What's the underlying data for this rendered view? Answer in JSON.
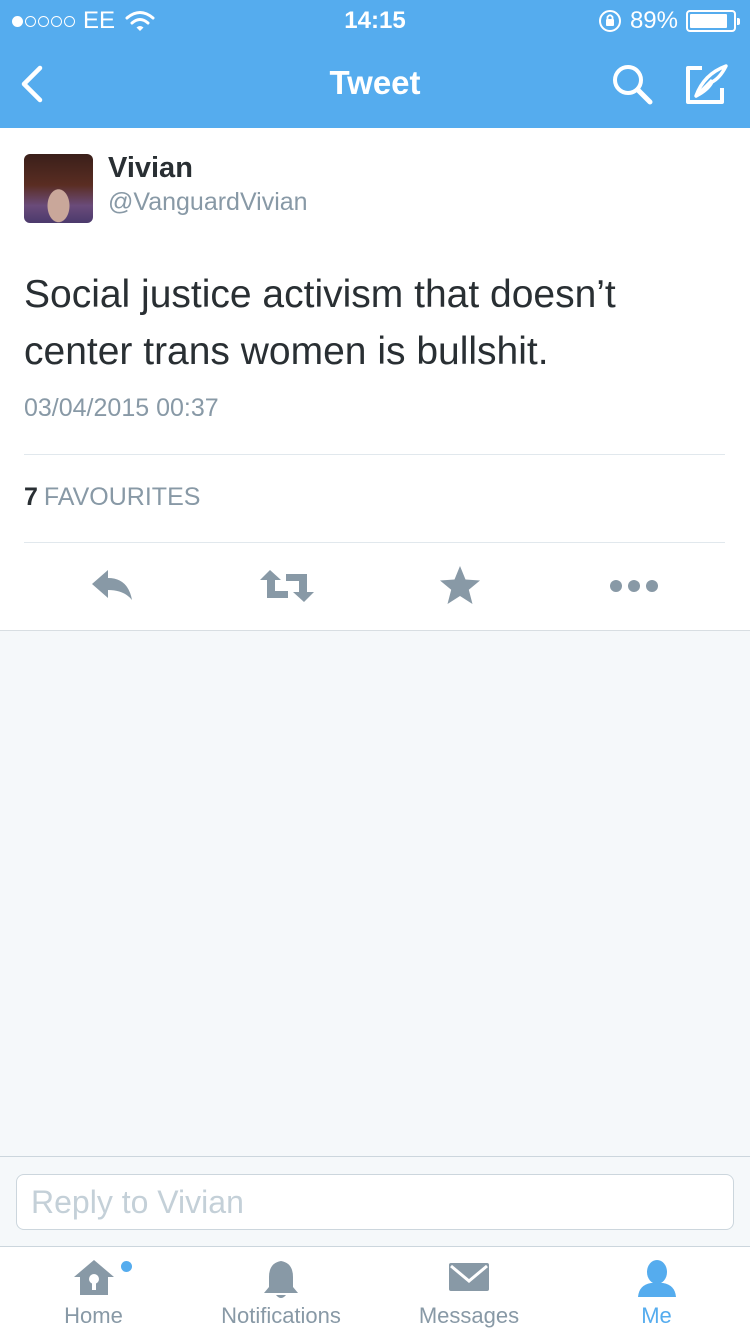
{
  "status_bar": {
    "signal_bars_filled": 1,
    "signal_bars_total": 5,
    "carrier": "EE",
    "time": "14:15",
    "battery_percent": "89%",
    "battery_level": 0.89
  },
  "nav": {
    "title": "Tweet",
    "back_icon": "chevron-left-icon",
    "search_icon": "search-icon",
    "compose_icon": "compose-icon"
  },
  "tweet": {
    "display_name": "Vivian",
    "handle": "@VanguardVivian",
    "text": "Social justice activism that doesn’t center trans women is bullshit.",
    "timestamp": "03/04/2015 00:37",
    "favourites_count": "7",
    "favourites_label": "FAVOURITES"
  },
  "actions": [
    "reply-icon",
    "retweet-icon",
    "favourite-icon",
    "more-icon"
  ],
  "reply": {
    "placeholder": "Reply to Vivian"
  },
  "tabs": [
    {
      "label": "Home",
      "icon": "home-icon",
      "active": false,
      "has_dot": true
    },
    {
      "label": "Notifications",
      "icon": "bell-icon",
      "active": false,
      "has_dot": false
    },
    {
      "label": "Messages",
      "icon": "envelope-icon",
      "active": false,
      "has_dot": false
    },
    {
      "label": "Me",
      "icon": "person-icon",
      "active": true,
      "has_dot": false
    }
  ],
  "colors": {
    "brand": "#55acee",
    "text": "#292f33",
    "secondary_text": "#8899a6",
    "icon_gray": "#8899a6",
    "background": "#f5f8fa"
  }
}
